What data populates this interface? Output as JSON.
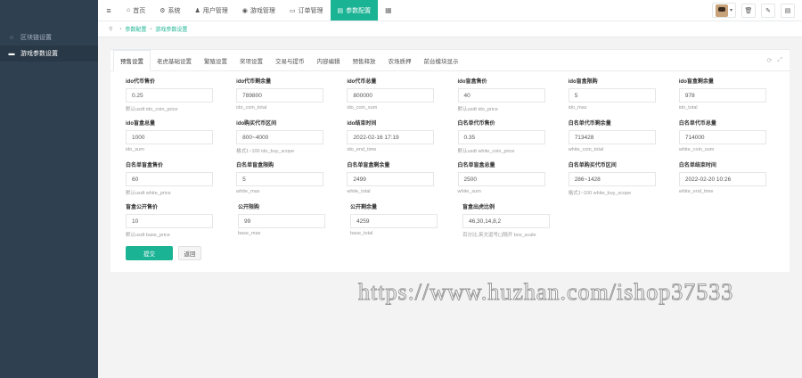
{
  "sidebar": {
    "items": [
      {
        "label": "区块链设置",
        "icon": "circle-icon",
        "active": false
      },
      {
        "label": "游戏参数设置",
        "icon": "hdd-icon",
        "active": true
      }
    ]
  },
  "topnav": {
    "items": [
      {
        "label": "首页",
        "icon": "home-icon",
        "glyph": "⌂",
        "active": false
      },
      {
        "label": "系统",
        "icon": "gear-icon",
        "glyph": "⚙",
        "active": false
      },
      {
        "label": "用户管理",
        "icon": "user-icon",
        "glyph": "♟",
        "active": false
      },
      {
        "label": "游戏管理",
        "icon": "game-icon",
        "glyph": "◉",
        "active": false
      },
      {
        "label": "订单管理",
        "icon": "order-icon",
        "glyph": "▭",
        "active": false
      },
      {
        "label": "参数配置",
        "icon": "config-icon",
        "glyph": "▤",
        "active": true
      }
    ]
  },
  "breadcrumb": {
    "items": [
      "参数配置",
      "游戏参数设置"
    ]
  },
  "tabs": [
    {
      "label": "预售设置",
      "active": true
    },
    {
      "label": "老虎基础设置",
      "active": false
    },
    {
      "label": "繁殖设置",
      "active": false
    },
    {
      "label": "奖项设置",
      "active": false
    },
    {
      "label": "交易与提币",
      "active": false
    },
    {
      "label": "内容编辑",
      "active": false
    },
    {
      "label": "预售释放",
      "active": false
    },
    {
      "label": "农场质押",
      "active": false
    },
    {
      "label": "前台模块显示",
      "active": false
    }
  ],
  "rows": [
    [
      {
        "label": "ido代币售价",
        "value": "0.25",
        "help": "默认usdt ido_coin_price"
      },
      {
        "label": "ido代币剩余量",
        "value": "789800",
        "help": "ido_coin_total"
      },
      {
        "label": "ido代币总量",
        "value": "800000",
        "help": "ido_coin_sum"
      },
      {
        "label": "ido盲盒售价",
        "value": "40",
        "help": "默认usdt ido_price"
      },
      {
        "label": "ido盲盒限购",
        "value": "5",
        "help": "ido_max"
      },
      {
        "label": "ido盲盒剩余量",
        "value": "978",
        "help": "ido_total"
      }
    ],
    [
      {
        "label": "ido盲盒总量",
        "value": "1000",
        "help": "ido_sum"
      },
      {
        "label": "ido购买代币区间",
        "value": "800~4000",
        "help": "格式1~100 ido_buy_scope"
      },
      {
        "label": "ido结束时间",
        "value": "2022-02-16 17:19",
        "help": "ido_end_time"
      },
      {
        "label": "白名单代币售价",
        "value": "0.35",
        "help": "默认usdt white_coin_price"
      },
      {
        "label": "白名单代币剩余量",
        "value": "713428",
        "help": "white_coin_total"
      },
      {
        "label": "白名单代币总量",
        "value": "714000",
        "help": "white_coin_sum"
      }
    ],
    [
      {
        "label": "白名单盲盒售价",
        "value": "60",
        "help": "默认usdt white_price"
      },
      {
        "label": "白名单盲盒限购",
        "value": "5",
        "help": "white_max"
      },
      {
        "label": "白名单盲盒剩余量",
        "value": "2499",
        "help": "white_total"
      },
      {
        "label": "白名单盲盒总量",
        "value": "2500",
        "help": "white_sum"
      },
      {
        "label": "白名单购买代币区间",
        "value": "286~1428",
        "help": "格式1~100 white_buy_scope"
      },
      {
        "label": "白名单结束时间",
        "value": "2022-02-20 10:26",
        "help": "white_end_time"
      }
    ],
    [
      {
        "label": "盲盒公开售价",
        "value": "10",
        "help": "默认usdt base_price"
      },
      {
        "label": "公开限购",
        "value": "99",
        "help": "base_max"
      },
      {
        "label": "公开剩余量",
        "value": "4259",
        "help": "base_total"
      },
      {
        "label": "盲盒出虎比例",
        "value": "46,30,14,8,2",
        "help": "百分比,英文逗号(,)隔开 box_scale"
      }
    ]
  ],
  "actions": {
    "submit": "提交",
    "back": "返回"
  },
  "watermark": "https://www.huzhan.com/ishop37533",
  "colors": {
    "accent": "#1ab394",
    "sidebar": "#2f4050"
  }
}
